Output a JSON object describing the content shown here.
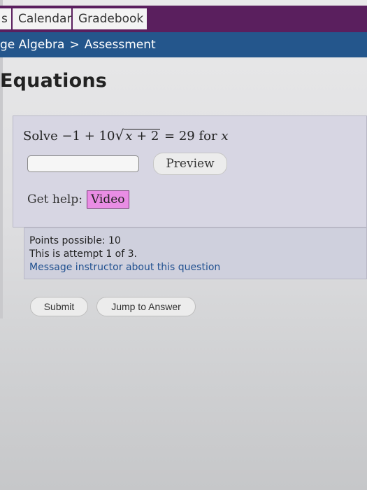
{
  "nav": {
    "items": [
      {
        "label": "s"
      },
      {
        "label": "Calendar"
      },
      {
        "label": "Gradebook"
      }
    ]
  },
  "breadcrumb": {
    "course": "ge Algebra",
    "separator": ">",
    "current": "Assessment"
  },
  "page": {
    "title": "Equations"
  },
  "question": {
    "prefix": "Solve ",
    "expr_lead": "−1 + 10",
    "radicand_var": "x",
    "radicand_rest": " + 2",
    "expr_tail": " = 29 for ",
    "target_var": "x",
    "answer_value": "",
    "preview_label": "Preview",
    "help_label": "Get help:",
    "video_label": "Video"
  },
  "info": {
    "points": "Points possible: 10",
    "attempt": "This is attempt 1 of 3.",
    "message_link": "Message instructor about this question"
  },
  "actions": {
    "submit_label": "Submit",
    "jump_label": "Jump to Answer"
  },
  "colors": {
    "nav_bg": "#5a1f5e",
    "breadcrumb_bg": "#24568c",
    "question_bg": "#d7d6e3",
    "video_bg": "#e98de4",
    "link": "#1f4f8f"
  }
}
